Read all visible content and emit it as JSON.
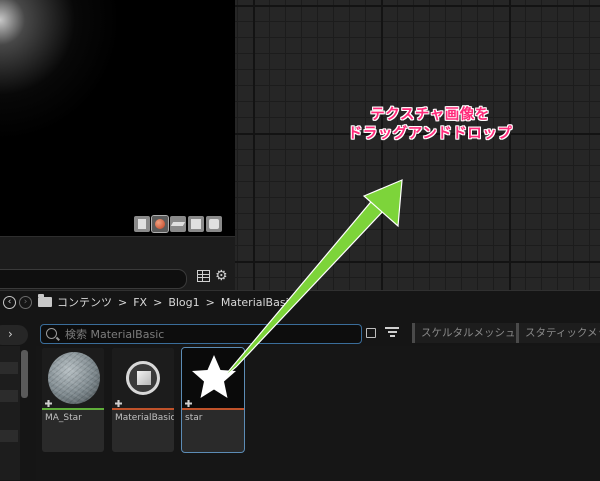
{
  "annotation": {
    "line1": "テクスチャ画像を",
    "line2": "ドラッグアンドドロップ",
    "color": "#ff2a7a",
    "arrow_color": "#7dd43a"
  },
  "viewport": {
    "preview_buttons": [
      "cylinder-icon",
      "sphere-icon",
      "plane-icon",
      "cube-icon",
      "mesh-icon"
    ],
    "active_preview": "sphere-icon"
  },
  "breadcrumb": {
    "items": [
      "コンテンツ",
      "FX",
      "Blog1",
      "MaterialBasic"
    ],
    "separator": ">"
  },
  "content_browser": {
    "search_placeholder": "検索 MaterialBasic",
    "filters": [
      "スケルタルメッシュ",
      "スタティックメッシュ"
    ]
  },
  "assets": [
    {
      "name": "MA_Star",
      "type": "material-instance",
      "bar_color": "#5fae3a",
      "thumb": "sphere"
    },
    {
      "name": "MaterialBasic",
      "type": "material",
      "bar_color": "#c0522a",
      "thumb": "material-icon"
    },
    {
      "name": "star",
      "type": "texture",
      "bar_color": "#c0522a",
      "thumb": "star",
      "selected": true
    }
  ]
}
